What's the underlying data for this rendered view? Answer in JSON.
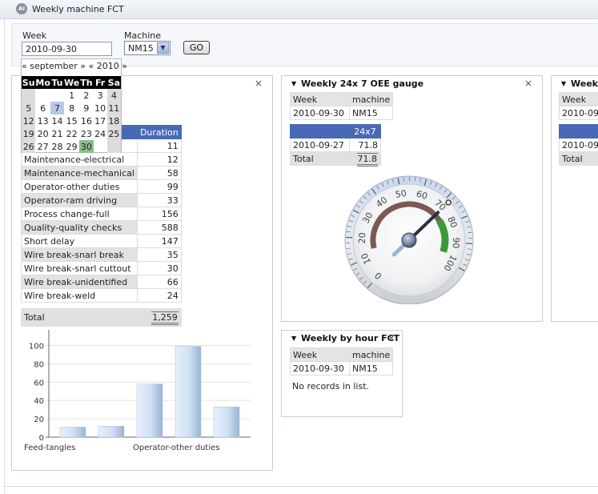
{
  "app": {
    "title": "Weekly machine FCT",
    "logo": "AI"
  },
  "toolbar": {
    "week_label": "Week",
    "week_value": "2010-09-30",
    "machine_label": "Machine",
    "machine_value": "NM15",
    "go_label": "GO"
  },
  "calendar": {
    "prev_month": "«",
    "month": "september",
    "next_month": "»",
    "prev_year": "«",
    "year": "2010",
    "next_year": "»",
    "day_names": [
      "Su",
      "Mo",
      "Tu",
      "We",
      "Th",
      "Fr",
      "Sa"
    ],
    "weeks": [
      [
        "",
        "",
        "",
        "1",
        "2",
        "3",
        "4"
      ],
      [
        "5",
        "6",
        "7",
        "8",
        "9",
        "10",
        "11"
      ],
      [
        "12",
        "13",
        "14",
        "15",
        "16",
        "17",
        "18"
      ],
      [
        "19",
        "20",
        "21",
        "22",
        "23",
        "24",
        "25"
      ],
      [
        "26",
        "27",
        "28",
        "29",
        "30",
        "",
        ""
      ]
    ],
    "selected_day": "7",
    "today_day": "30"
  },
  "duration_panel": {
    "close": "×",
    "header": "Duration",
    "rows": [
      {
        "label": "",
        "value": "11"
      },
      {
        "label": "Maintenance-electrical",
        "value": "12"
      },
      {
        "label": "Maintenance-mechanical",
        "value": "58"
      },
      {
        "label": "Operator-other duties",
        "value": "99"
      },
      {
        "label": "Operator-ram driving",
        "value": "33"
      },
      {
        "label": "Process change-full",
        "value": "156"
      },
      {
        "label": "Quality-quality checks",
        "value": "588"
      },
      {
        "label": "Short delay",
        "value": "147"
      },
      {
        "label": "Wire break-snarl break",
        "value": "35"
      },
      {
        "label": "Wire break-snarl cuttout",
        "value": "30"
      },
      {
        "label": "Wire break-unidentified",
        "value": "66"
      },
      {
        "label": "Wire break-weld",
        "value": "24"
      }
    ],
    "total_label": "Total",
    "total_value": "1,259"
  },
  "chart_data": {
    "type": "bar",
    "categories": [
      "Feed-tangles",
      "Maintenance-electrical",
      "Maintenance-mechanical",
      "Operator-other duties",
      "Operator-ram driving"
    ],
    "values": [
      11,
      12,
      58,
      99,
      33
    ],
    "ylim": [
      0,
      110
    ],
    "yticks": [
      0,
      20,
      40,
      60,
      80,
      100
    ],
    "visible_xlabels": [
      "Feed-tangles",
      "Operator-other duties"
    ],
    "grid": true,
    "bar_color": "#cfe0f3"
  },
  "oee_panel": {
    "title": "Weekly 24x 7 OEE gauge",
    "close": "×",
    "week_label": "Week",
    "machine_label": "machine",
    "week_value": "2010-09-30",
    "machine_value": "NM15",
    "col_header": "24x7",
    "row_week": "2010-09-27",
    "row_value": "71.8",
    "total_label": "Total",
    "total_value": "71.8",
    "gauge": {
      "value": 71.8,
      "min": 0,
      "max": 100,
      "ticks": [
        "0",
        "10",
        "20",
        "30",
        "40",
        "50",
        "60",
        "70",
        "80",
        "90",
        "100"
      ],
      "red_color": "#7a5a50",
      "green_color": "#3a9a3a"
    }
  },
  "hour_panel": {
    "title": "Weekly by hour FCT",
    "close": "×",
    "week_label": "Week",
    "machine_label": "machine",
    "week_value": "2010-09-30",
    "machine_value": "NM15",
    "empty_text": "No records in list."
  },
  "third_panel": {
    "title": "Weekl",
    "week_label": "Week",
    "week_value": "2010-09",
    "row_week": "2010-09",
    "total_label": "Total"
  }
}
